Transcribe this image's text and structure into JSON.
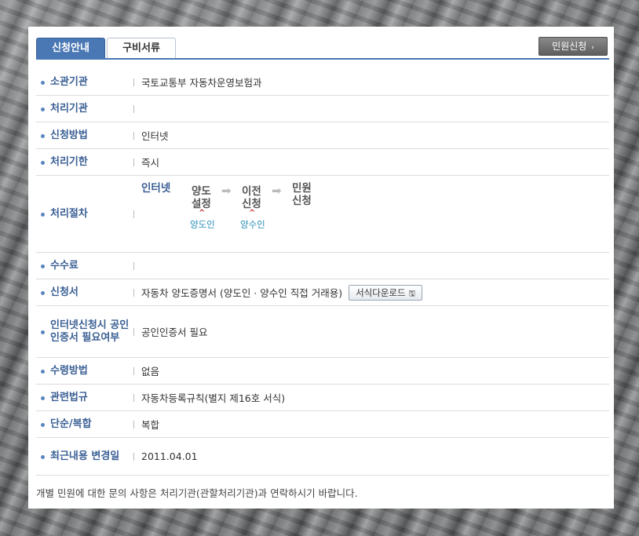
{
  "tabs": {
    "active": "신청안내",
    "inactive": "구비서류"
  },
  "apply_button": {
    "label": "민원신청",
    "arrow": "›"
  },
  "rows": [
    {
      "label": "소관기관",
      "value": "국토교통부 자동차운영보험과"
    },
    {
      "label": "처리기관",
      "value": ""
    },
    {
      "label": "신청방법",
      "value": "인터넷"
    },
    {
      "label": "처리기한",
      "value": "즉시"
    },
    {
      "label": "처리절차",
      "value": ""
    },
    {
      "label": "수수료",
      "value": ""
    },
    {
      "label": "신청서",
      "value": "자동차 양도증명서 (양도인 · 양수인 직접 거래용)"
    },
    {
      "label": "인터넷신청시 공인인증서 필요여부",
      "value": "공인인증서 필요"
    },
    {
      "label": "수령방법",
      "value": "없음"
    },
    {
      "label": "관련법규",
      "value": "자동차등록규칙(별지 제16호 서식)"
    },
    {
      "label": "단순/복합",
      "value": "복합"
    },
    {
      "label": "최근내용 변경일",
      "value": "2011.04.01"
    }
  ],
  "download_button": {
    "label": "서식다운로드",
    "icon": "disk-icon"
  },
  "procedure": {
    "first": "인터넷",
    "steps": [
      {
        "line1": "양도",
        "line2": "설정",
        "who": "양도인"
      },
      {
        "line1": "이전",
        "line2": "신청",
        "who": "양수인"
      },
      {
        "line1": "민원",
        "line2": "신청"
      }
    ],
    "arrow": "➡",
    "caret": "^"
  },
  "footer": "개별 민원에 대한 문의 사항은 처리기관(관할처리기관)과 연락하시기 바랍니다."
}
